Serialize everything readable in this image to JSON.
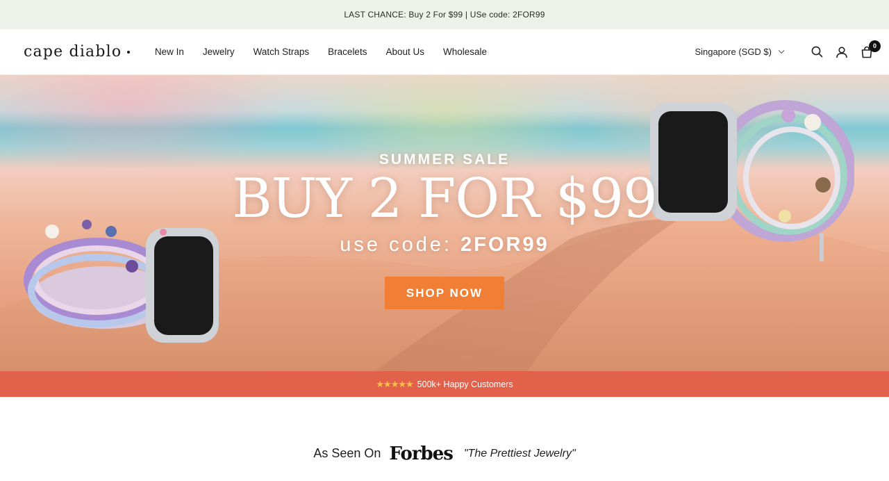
{
  "announcement": {
    "text": "LAST CHANCE: Buy 2 For $99 | USe code: 2FOR99"
  },
  "header": {
    "logo": "cape diablo",
    "nav": [
      "New In",
      "Jewelry",
      "Watch Straps",
      "Bracelets",
      "About Us",
      "Wholesale"
    ],
    "locale": "Singapore (SGD $)",
    "cart_count": "0",
    "icons": [
      "search-icon",
      "account-icon",
      "cart-icon",
      "chevron-down-icon"
    ]
  },
  "hero": {
    "sale_label": "SUMMER SALE",
    "headline": "BUY 2 FOR $99",
    "code_prefix": "use code:",
    "code": "2FOR99",
    "cta": "SHOP NOW"
  },
  "customers_bar": {
    "stars": "★★★★★",
    "text": "500k+ Happy Customers"
  },
  "press": {
    "label": "As Seen On",
    "publication": "Forbes",
    "quote": "\"The Prettiest Jewelry\""
  },
  "colors": {
    "cta": "#f07f35",
    "customers_bar": "#e2614b",
    "announcement_bg": "#eef1ea"
  }
}
